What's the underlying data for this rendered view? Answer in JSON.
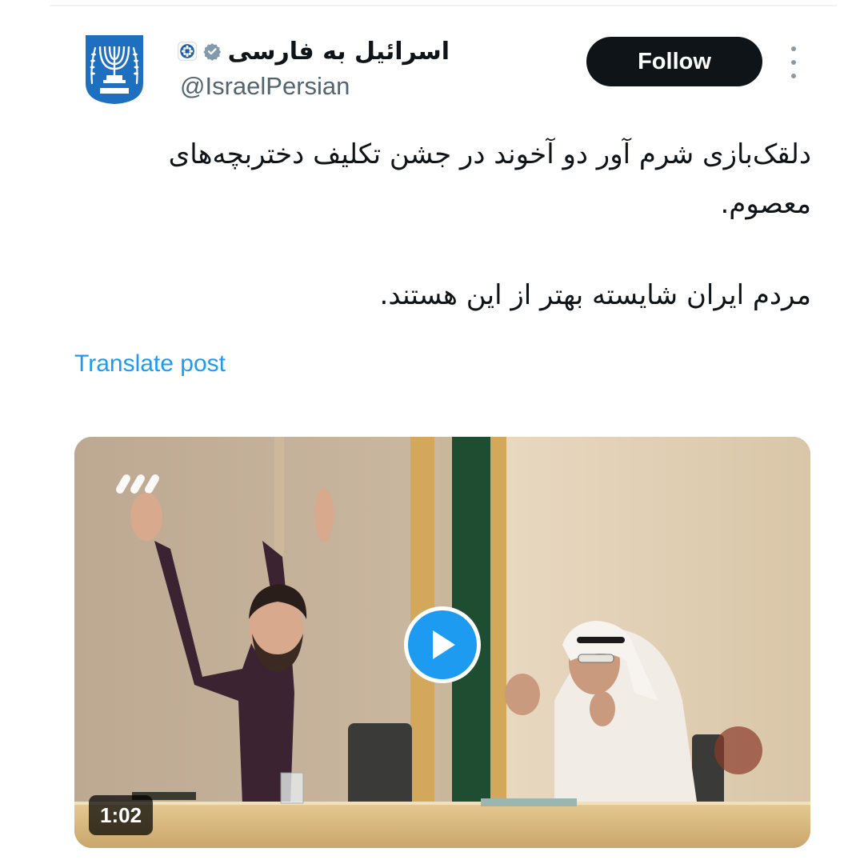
{
  "author": {
    "display_name": "اسرائیل به فارسی",
    "handle": "@IsraelPersian",
    "avatar_icon": "israel-emblem-icon",
    "verified_icon": "verified-badge-icon",
    "affiliate_icon": "affiliate-badge-icon"
  },
  "actions": {
    "follow_label": "Follow",
    "more_icon": "more-options-icon"
  },
  "post": {
    "paragraphs": [
      "دلقک‌بازی شرم آور دو آخوند در جشن تکلیف دختربچه‌های معصوم.",
      "مردم ایران شایسته بهتر از این هستند."
    ],
    "translate_label": "Translate post"
  },
  "media": {
    "type": "video",
    "duration": "1:02",
    "play_icon": "play-icon"
  },
  "colors": {
    "accent": "#1d9bf0",
    "text": "#0f1419",
    "secondary_text": "#536471",
    "follow_bg": "#0f1419"
  }
}
